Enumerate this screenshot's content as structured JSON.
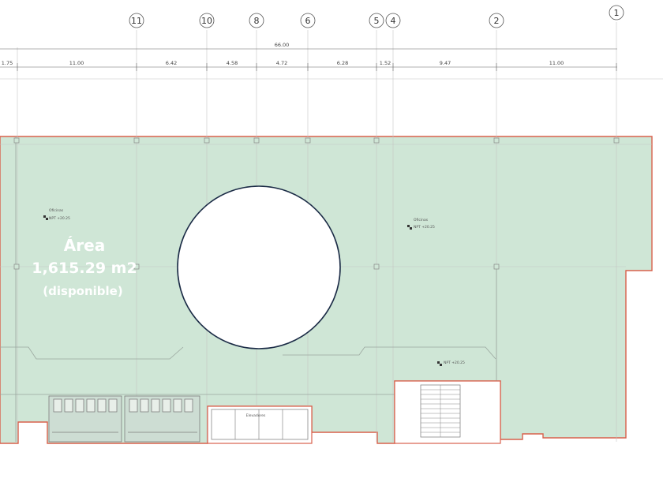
{
  "grid_axes": [
    "11",
    "10",
    "8",
    "6",
    "5",
    "4",
    "2",
    "1"
  ],
  "overall_dimension": "66.00",
  "segment_dimensions": [
    "1.75",
    "11.00",
    "6.42",
    "4.58",
    "4.72",
    "6.28",
    "1.52",
    "9.47",
    "11.00"
  ],
  "area": {
    "title": "Área",
    "value": "1,615.29 m2",
    "status": "(disponible)"
  },
  "room_labels": {
    "office_left": "Oficinas",
    "office_right": "Oficinas",
    "elevators": "Elevadores"
  },
  "level_tags": [
    "NPT +20.25",
    "NPT +20.25",
    "NPT +20.25"
  ],
  "colors": {
    "floor_fill": "#cfe6d6",
    "outline": "#d9604c",
    "grid": "#c4c4c4",
    "structure": "#888888",
    "circle_stroke": "#1b2b46"
  }
}
